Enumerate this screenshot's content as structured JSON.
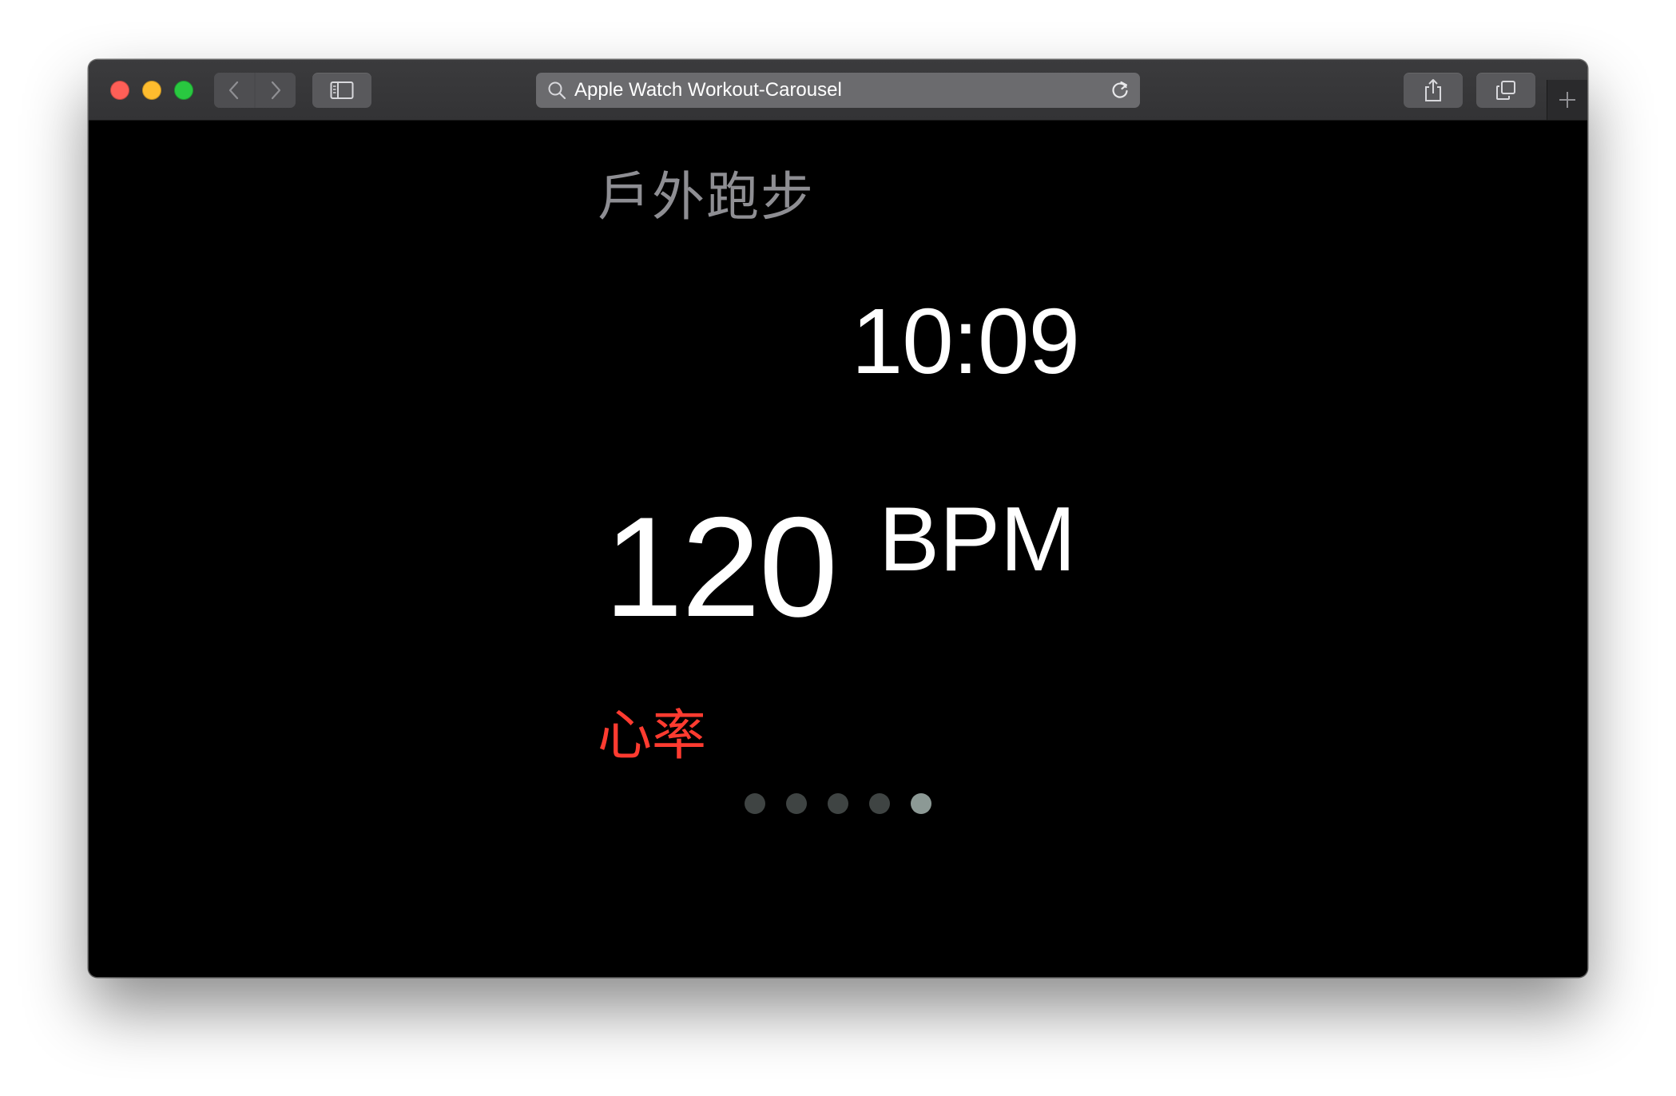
{
  "browser": {
    "url_text": "Apple Watch Workout-Carousel"
  },
  "icons": {
    "close": "red-traffic-light",
    "minimize": "yellow-traffic-light",
    "zoom": "green-traffic-light",
    "back": "chevron-left-icon",
    "forward": "chevron-right-icon",
    "sidebar": "sidebar-icon",
    "search": "search-icon",
    "reload": "reload-icon",
    "share": "share-icon",
    "tabs": "tabs-overview-icon",
    "new_tab": "plus-icon"
  },
  "workout": {
    "title": "戶外跑步",
    "elapsed_time": "10:09",
    "heart_rate_value": "120",
    "heart_rate_unit": "BPM",
    "metric_label": "心率"
  },
  "pager": {
    "total_pages": 5,
    "active_index": 4
  },
  "colors": {
    "background": "#000000",
    "title_gray": "#8e8e93",
    "value_white": "#ffffff",
    "metric_red": "#ff3b30",
    "dot_inactive": "#3f4443",
    "dot_active": "#8c9995"
  }
}
